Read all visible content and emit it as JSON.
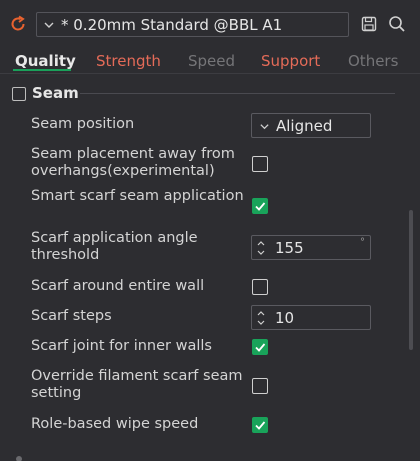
{
  "colors": {
    "accent_green": "#19a35a",
    "tab_modified_red": "#e46b58",
    "background": "#2d2d31"
  },
  "preset": {
    "label": "* 0.20mm Standard @BBL A1",
    "icon": "chevron-down-icon"
  },
  "toolbar": {
    "sync_icon": "sync-icon",
    "save_icon": "save-icon",
    "search_icon": "search-icon"
  },
  "tabs": [
    {
      "label": "Quality",
      "state": "active"
    },
    {
      "label": "Strength",
      "state": "modified"
    },
    {
      "label": "Speed",
      "state": "normal"
    },
    {
      "label": "Support",
      "state": "modified"
    },
    {
      "label": "Others",
      "state": "normal"
    }
  ],
  "section": {
    "title": "Seam",
    "icon": "seam-section-icon"
  },
  "settings": {
    "seam_position": {
      "label": "Seam position",
      "value": "Aligned"
    },
    "seam_away_overhangs": {
      "label": "Seam placement away from overhangs(experimental)",
      "checked": false
    },
    "smart_scarf": {
      "label": "Smart scarf seam application",
      "checked": true
    },
    "scarf_angle": {
      "label": "Scarf application angle threshold",
      "value": "155",
      "unit": "°"
    },
    "scarf_entire_wall": {
      "label": "Scarf around entire wall",
      "checked": false
    },
    "scarf_steps": {
      "label": "Scarf steps",
      "value": "10"
    },
    "scarf_inner_walls": {
      "label": "Scarf joint for inner walls",
      "checked": true
    },
    "override_filament_scarf": {
      "label": "Override filament scarf seam setting",
      "checked": false
    },
    "role_based_wipe": {
      "label": "Role-based wipe speed",
      "checked": true
    }
  }
}
